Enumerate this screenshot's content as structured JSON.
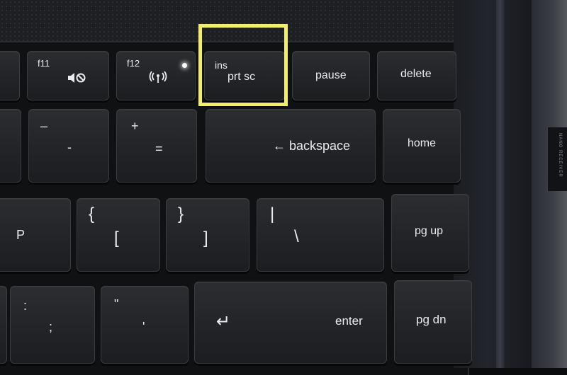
{
  "keys": {
    "f11": {
      "fn_label": "f11"
    },
    "f12": {
      "fn_label": "f12"
    },
    "prtsc": {
      "top_label": "ins",
      "main_label": "prt sc"
    },
    "pause": {
      "label": "pause"
    },
    "delete": {
      "label": "delete"
    },
    "minus": {
      "top_label": "–",
      "bottom_label": "-"
    },
    "equals": {
      "top_label": "+",
      "bottom_label": "="
    },
    "backspace": {
      "label": "← backspace"
    },
    "home": {
      "label": "home"
    },
    "p": {
      "label": "P"
    },
    "bracket_left": {
      "top_label": "{",
      "bottom_label": "["
    },
    "bracket_right": {
      "top_label": "}",
      "bottom_label": "]"
    },
    "backslash": {
      "top_label": "|",
      "bottom_label": "\\"
    },
    "pgup": {
      "label": "pg up"
    },
    "semicolon": {
      "top_label": ":",
      "bottom_label": ";"
    },
    "quote": {
      "top_label": "\"",
      "bottom_label": "'"
    },
    "enter": {
      "label": "enter",
      "arrow": "↵"
    },
    "pgdn": {
      "label": "pg dn"
    }
  },
  "icons": {
    "f11": "mute-icon",
    "f12": "wireless-icon"
  },
  "highlight": {
    "color": "#f2ee6c",
    "target": "prt sc"
  },
  "side_label": "NANO RECEIVER"
}
